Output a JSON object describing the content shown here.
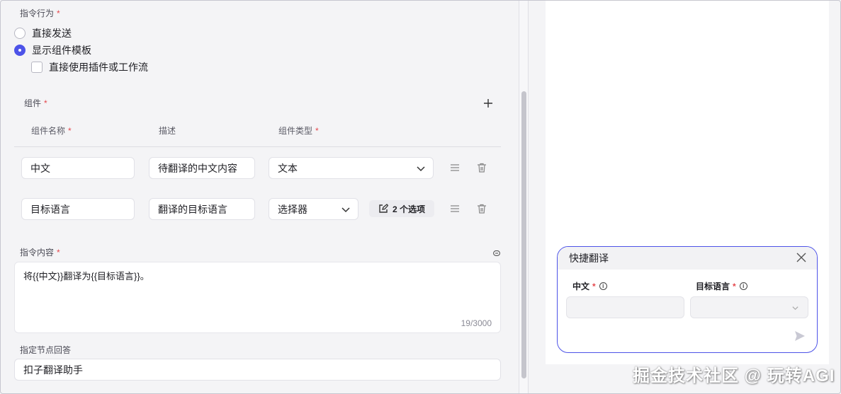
{
  "instruction_behavior": {
    "label": "指令行为",
    "required": "*",
    "options": [
      {
        "label": "直接发送",
        "checked": false
      },
      {
        "label": "显示组件模板",
        "checked": true
      }
    ],
    "checkbox_label": "直接使用插件或工作流",
    "checkbox_checked": false
  },
  "components": {
    "label": "组件",
    "required": "*",
    "headers": {
      "name": "组件名称",
      "desc": "描述",
      "type": "组件类型"
    },
    "rows": [
      {
        "name": "中文",
        "desc": "待翻译的中文内容",
        "type": "文本"
      },
      {
        "name": "目标语言",
        "desc": "翻译的目标语言",
        "type": "选择器",
        "options_button": "2 个选项"
      }
    ]
  },
  "instruction_content": {
    "label": "指令内容",
    "required": "*",
    "value": "将{{中文}}翻译为{{目标语言}}。",
    "counter": "19/3000"
  },
  "reply_node": {
    "label": "指定节点回答",
    "value": "扣子翻译助手"
  },
  "preview_card": {
    "title": "快捷翻译",
    "fields": [
      {
        "label": "中文",
        "required": "*"
      },
      {
        "label": "目标语言",
        "required": "*"
      }
    ]
  },
  "watermark": "掘金技术社区 @ 玩转AGI",
  "colors": {
    "accent": "#4d53e8",
    "required": "#e5484d"
  }
}
